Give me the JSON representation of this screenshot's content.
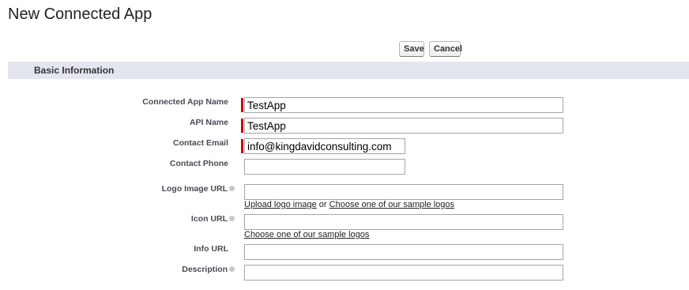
{
  "page": {
    "title": "New Connected App"
  },
  "toolbar": {
    "save_label": "Save",
    "cancel_label": "Cancel"
  },
  "section": {
    "title": "Basic Information"
  },
  "fields": {
    "connected_app_name": {
      "label": "Connected App Name",
      "value": "TestApp",
      "required": true
    },
    "api_name": {
      "label": "API Name",
      "value": "TestApp",
      "required": true
    },
    "contact_email": {
      "label": "Contact Email",
      "value": "info@kingdavidconsulting.com",
      "required": true
    },
    "contact_phone": {
      "label": "Contact Phone",
      "value": ""
    },
    "logo_image_url": {
      "label": "Logo Image URL",
      "value": "",
      "upload_link": "Upload logo image",
      "or_text": "or",
      "sample_link": "Choose one of our sample logos"
    },
    "icon_url": {
      "label": "Icon URL",
      "value": "",
      "sample_link": "Choose one of our sample logos"
    },
    "info_url": {
      "label": "Info URL",
      "value": ""
    },
    "description": {
      "label": "Description",
      "value": ""
    }
  },
  "colors": {
    "required_indicator": "#cc0000",
    "section_header_bg": "#e3e6ef"
  }
}
